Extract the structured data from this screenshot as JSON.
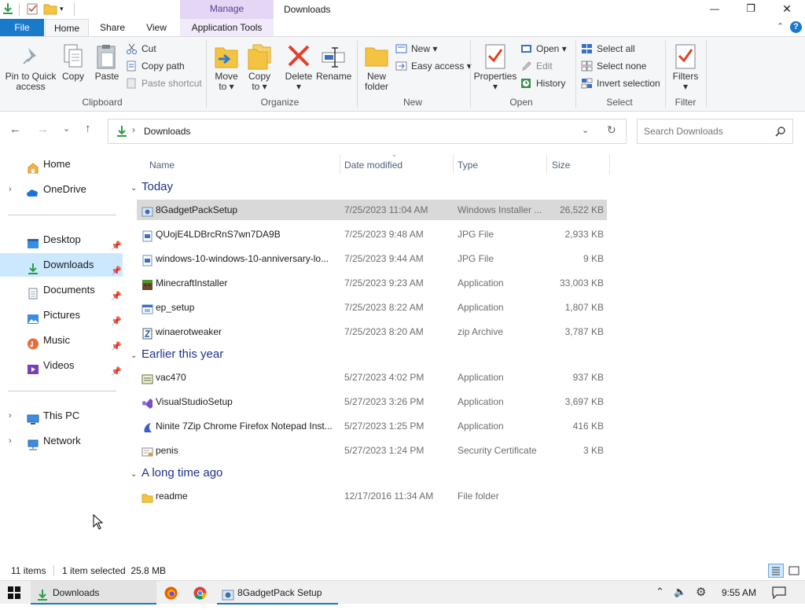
{
  "window": {
    "title": "Downloads",
    "manage_label": "Manage",
    "controls": {
      "minimize": "—",
      "maximize": "❐",
      "close": "✕"
    }
  },
  "tabs": [
    {
      "label": "File"
    },
    {
      "label": "Home"
    },
    {
      "label": "Share"
    },
    {
      "label": "View"
    },
    {
      "label": "Application Tools"
    }
  ],
  "ribbon": {
    "clipboard": {
      "group_label": "Clipboard",
      "pin_label": "Pin to Quick\naccess",
      "copy_label": "Copy",
      "paste_label": "Paste",
      "cut_label": "Cut",
      "copy_path_label": "Copy path",
      "paste_shortcut_label": "Paste shortcut"
    },
    "organize": {
      "group_label": "Organize",
      "move_to_label": "Move\nto ▾",
      "copy_to_label": "Copy\nto ▾",
      "delete_label": "Delete\n▾",
      "rename_label": "Rename"
    },
    "new": {
      "group_label": "New",
      "new_folder_label": "New\nfolder",
      "new_item_label": "New ▾",
      "easy_access_label": "Easy access ▾"
    },
    "open": {
      "group_label": "Open",
      "properties_label": "Properties\n▾",
      "open_label": "Open ▾",
      "edit_label": "Edit",
      "history_label": "History"
    },
    "select": {
      "group_label": "Select",
      "select_all_label": "Select all",
      "select_none_label": "Select none",
      "invert_label": "Invert selection"
    },
    "filter": {
      "group_label": "Filter",
      "filters_label": "Filters\n▾"
    }
  },
  "address": {
    "path_label": "Downloads",
    "search_placeholder": "Search Downloads"
  },
  "nav": {
    "home": "Home",
    "onedrive": "OneDrive",
    "desktop": "Desktop",
    "downloads": "Downloads",
    "documents": "Documents",
    "pictures": "Pictures",
    "music": "Music",
    "videos": "Videos",
    "this_pc": "This PC",
    "network": "Network"
  },
  "columns": {
    "name": "Name",
    "date": "Date modified",
    "type": "Type",
    "size": "Size"
  },
  "groups": [
    {
      "label": "Today",
      "files": [
        {
          "name": "8GadgetPackSetup",
          "date": "7/25/2023 11:04 AM",
          "type": "Windows Installer ...",
          "size": "26,522 KB",
          "icon": "installer-icon"
        },
        {
          "name": "QUojE4LDBrcRnS7wn7DA9B",
          "date": "7/25/2023 9:48 AM",
          "type": "JPG File",
          "size": "2,933 KB",
          "icon": "jpg-file-icon"
        },
        {
          "name": "windows-10-windows-10-anniversary-lo...",
          "date": "7/25/2023 9:44 AM",
          "type": "JPG File",
          "size": "9 KB",
          "icon": "jpg-file-icon"
        },
        {
          "name": "MinecraftInstaller",
          "date": "7/25/2023 9:23 AM",
          "type": "Application",
          "size": "33,003 KB",
          "icon": "minecraft-icon"
        },
        {
          "name": "ep_setup",
          "date": "7/25/2023 8:22 AM",
          "type": "Application",
          "size": "1,807 KB",
          "icon": "application-icon"
        },
        {
          "name": "winaerotweaker",
          "date": "7/25/2023 8:20 AM",
          "type": "zip Archive",
          "size": "3,787 KB",
          "icon": "zip-archive-icon"
        }
      ]
    },
    {
      "label": "Earlier this year",
      "files": [
        {
          "name": "vac470",
          "date": "5/27/2023 4:02 PM",
          "type": "Application",
          "size": "937 KB",
          "icon": "application-icon"
        },
        {
          "name": "VisualStudioSetup",
          "date": "5/27/2023 3:26 PM",
          "type": "Application",
          "size": "3,697 KB",
          "icon": "visual-studio-icon"
        },
        {
          "name": "Ninite 7Zip Chrome Firefox Notepad Inst...",
          "date": "5/27/2023 1:25 PM",
          "type": "Application",
          "size": "416 KB",
          "icon": "ninite-icon"
        },
        {
          "name": "penis",
          "date": "5/27/2023 1:24 PM",
          "type": "Security Certificate",
          "size": "3 KB",
          "icon": "certificate-icon"
        }
      ]
    },
    {
      "label": "A long time ago",
      "files": [
        {
          "name": "readme",
          "date": "12/17/2016 11:34 AM",
          "type": "File folder",
          "size": "",
          "icon": "folder-icon"
        }
      ]
    }
  ],
  "status": {
    "item_count": "11 items",
    "selection": "1 item selected  25.8 MB"
  },
  "taskbar": {
    "explorer_label": "Downloads",
    "setup_label": "8GadgetPack Setup",
    "clock": "9:55 AM"
  }
}
